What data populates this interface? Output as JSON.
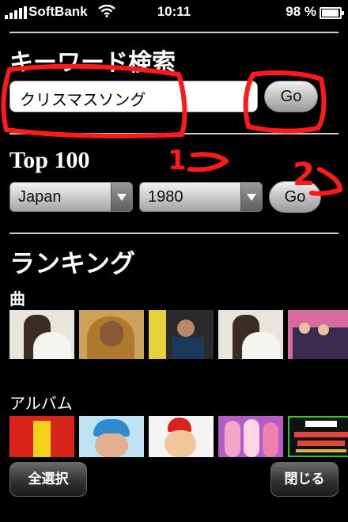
{
  "status_bar": {
    "carrier": "SoftBank",
    "time": "10:11",
    "battery": "98 %"
  },
  "keyword_search": {
    "title": "キーワード検索",
    "query": "クリスマスソング",
    "go_label": "Go"
  },
  "top100": {
    "title": "Top 100",
    "country": "Japan",
    "year": "1980",
    "go_label": "Go"
  },
  "ranking": {
    "title": "ランキング",
    "songs_label": "曲",
    "albums_label": "アルバム"
  },
  "bottom": {
    "select_all_label": "全選択",
    "close_label": "閉じる"
  },
  "annotations": {
    "label_1": "1",
    "label_2": "2",
    "color": "#ff1a1a"
  }
}
